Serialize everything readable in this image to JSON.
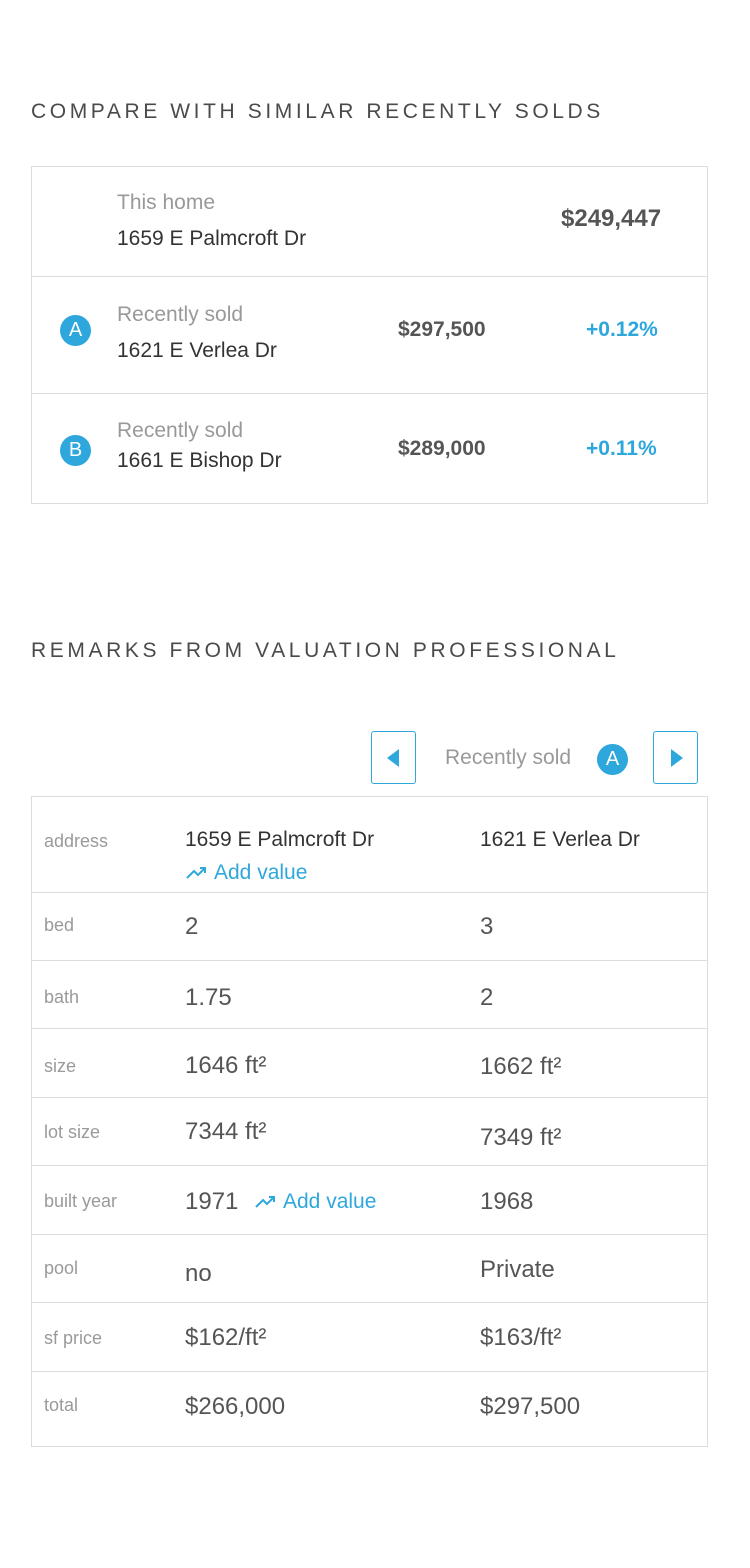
{
  "compare": {
    "title": "COMPARE WITH SIMILAR RECENTLY SOLDS",
    "home": {
      "label": "This home",
      "address": "1659 E Palmcroft Dr",
      "price": "$249,447"
    },
    "comps": [
      {
        "marker": "A",
        "label": "Recently sold",
        "address": "1621 E Verlea Dr",
        "price": "$297,500",
        "change": "+0.12%"
      },
      {
        "marker": "B",
        "label": "Recently sold",
        "address": "1661 E Bishop Dr",
        "price": "$289,000",
        "change": "+0.11%"
      }
    ]
  },
  "remarks": {
    "title": "REMARKS FROM VALUATION PROFESSIONAL",
    "navigator": {
      "label": "Recently sold",
      "marker": "A",
      "prev_icon": "caret-left-icon",
      "next_icon": "caret-right-icon"
    },
    "add_value_label": "Add value",
    "rows": [
      {
        "label": "address",
        "home": "1659 E Palmcroft Dr",
        "comp": "1621 E Verlea Dr"
      },
      {
        "label": "bed",
        "home": "2",
        "comp": "3"
      },
      {
        "label": "bath",
        "home": "1.75",
        "comp": "2"
      },
      {
        "label": "size",
        "home": "1646 ft²",
        "comp": "1662 ft²"
      },
      {
        "label": "lot size",
        "home": "7344 ft²",
        "comp": "7349 ft²"
      },
      {
        "label": "built year",
        "home": "1971",
        "comp": "1968"
      },
      {
        "label": "pool",
        "home": "no",
        "comp": "Private"
      },
      {
        "label": "sf price",
        "home": "$162/ft²",
        "comp": "$163/ft²"
      },
      {
        "label": "total",
        "home": "$266,000",
        "comp": "$297,500"
      }
    ]
  },
  "colors": {
    "accent": "#2ea7dc",
    "border": "#dcdcdc",
    "muted": "#999999"
  }
}
